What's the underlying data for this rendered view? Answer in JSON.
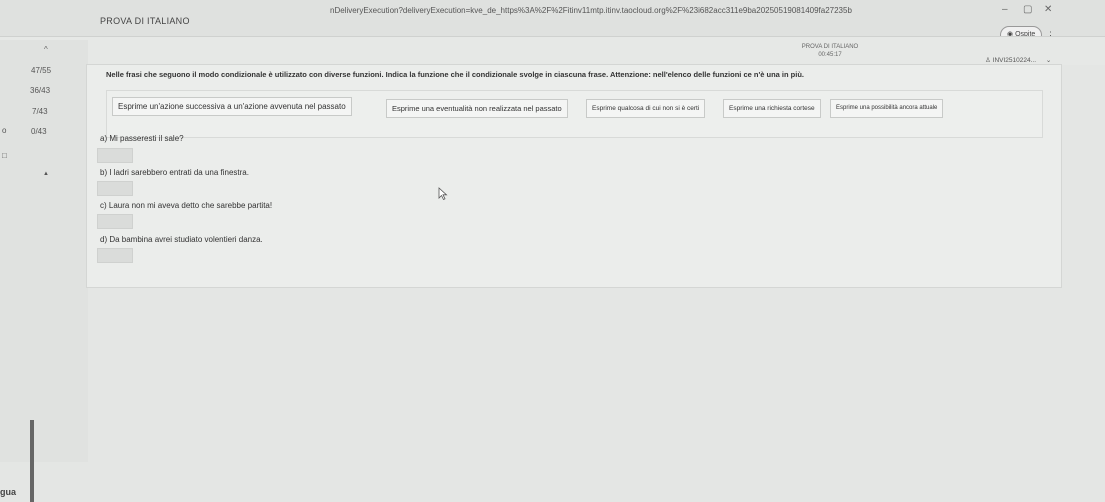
{
  "browser": {
    "url": "nDeliveryExecution?deliveryExecution=kve_de_https%3A%2F%2Fitinv11mtp.itinv.taocloud.org%2F%23i682acc311e9ba20250519081409fa27235b",
    "tab_title": "PROVA DI ITALIANO",
    "guest_label": "Ospite",
    "menu_label": "⋮",
    "minimize": "–",
    "maximize": "▢",
    "close": "✕"
  },
  "header": {
    "exam_title": "PROVA DI ITALIANO",
    "timer": "00:45:17",
    "user_label": "INVI2510224...",
    "user_chevron": "⌄"
  },
  "sidebar": {
    "collapse_label": "^",
    "counts": [
      "47/55",
      "36/43",
      "7/43",
      "0/43"
    ],
    "marks": [
      "o",
      "□",
      "▲"
    ],
    "language_label": "gua"
  },
  "item": {
    "instruction": "Nelle frasi che seguono il modo condizionale è utilizzato con diverse funzioni. Indica la funzione che il condizionale svolge in ciascuna frase. Attenzione: nell'elenco delle funzioni ce n'è una in più.",
    "options": [
      "Esprime un'azione successiva a un'azione avvenuta nel passato",
      "Esprime una eventualità non realizzata nel passato",
      "Esprime qualcosa di cui non si è certi",
      "Esprime una richiesta cortese",
      "Esprime una possibilità ancora attuale"
    ],
    "questions": [
      "a) Mi passeresti il sale?",
      "b) I ladri sarebbero entrati da una finestra.",
      "c) Laura non mi aveva detto che sarebbe partita!",
      "d) Da bambina avrei studiato volentieri danza."
    ]
  }
}
